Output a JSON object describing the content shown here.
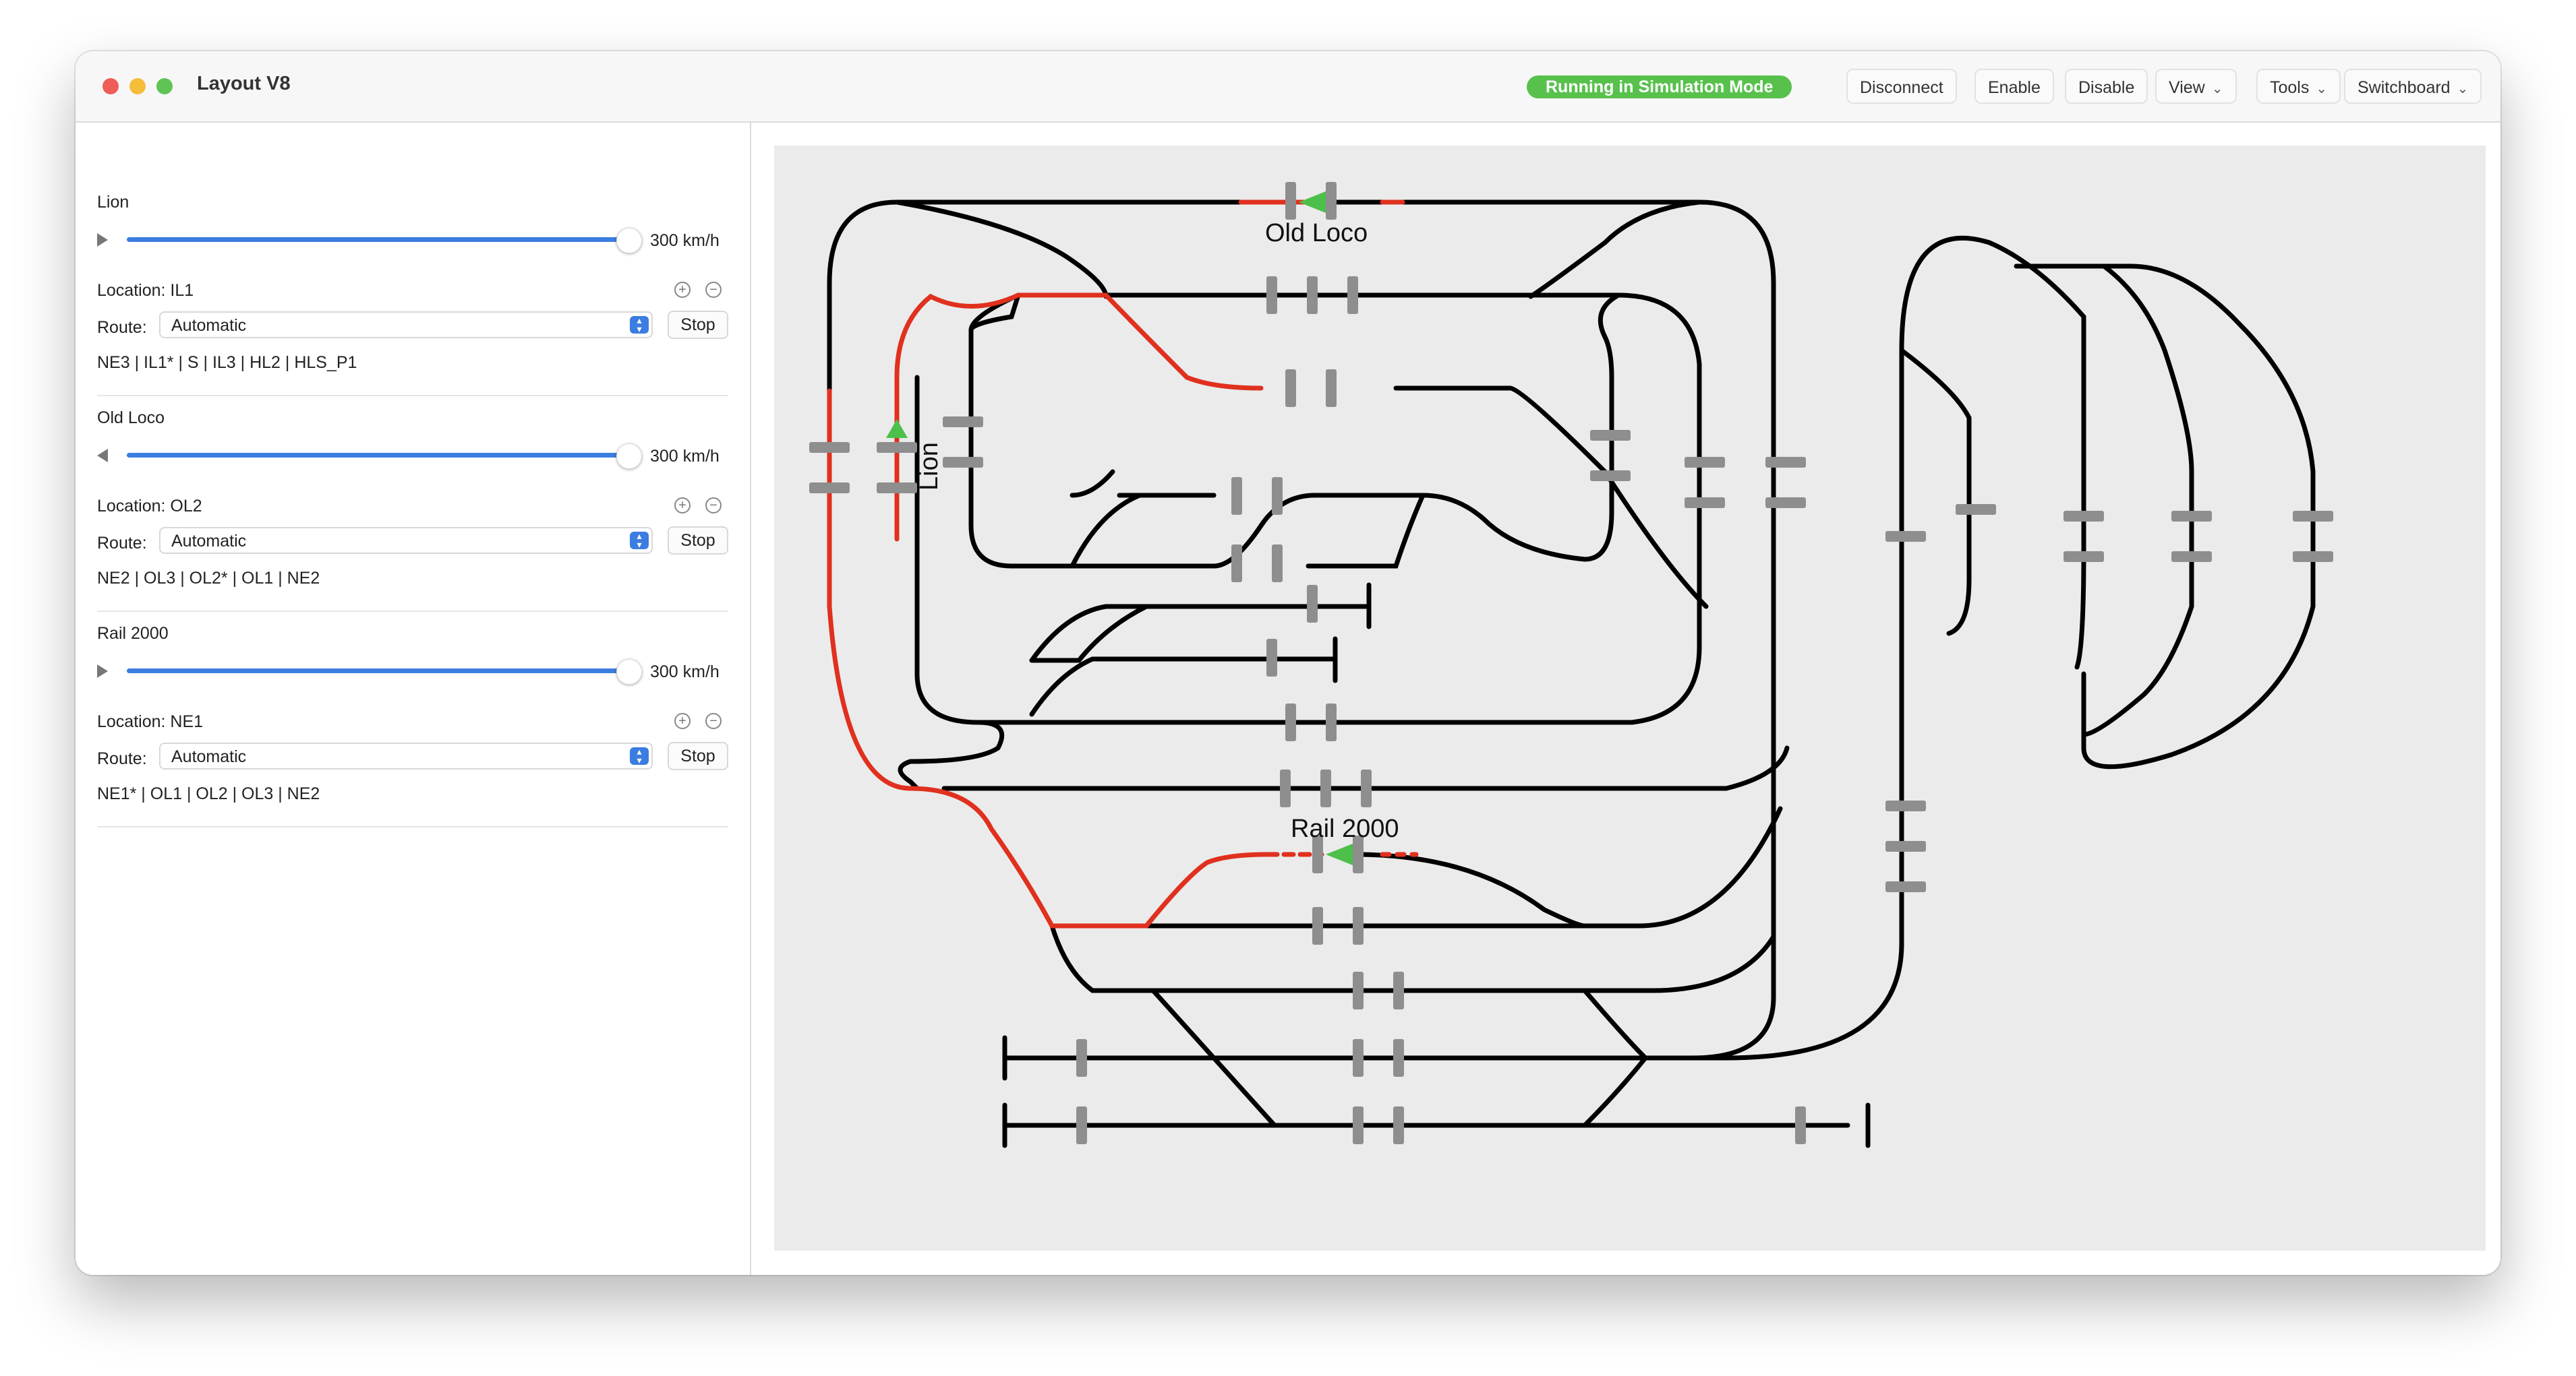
{
  "window": {
    "title": "Layout V8"
  },
  "toolbar": {
    "status": "Running in Simulation Mode",
    "status_color": "#58c14c",
    "disconnect": "Disconnect",
    "enable": "Enable",
    "disable": "Disable",
    "view": "View",
    "tools": "Tools",
    "switchboard": "Switchboard"
  },
  "trains": [
    {
      "name": "Lion",
      "direction_icon": "play-icon",
      "speed": "300 km/h",
      "speed_fraction": 1.0,
      "location": "Location: IL1",
      "route_label": "Route:",
      "route": "Automatic",
      "stop": "Stop",
      "path": "NE3 | IL1* | S | IL3 | HL2 | HLS_P1"
    },
    {
      "name": "Old Loco",
      "direction_icon": "back-icon",
      "speed": "300 km/h",
      "speed_fraction": 1.0,
      "location": "Location: OL2",
      "route_label": "Route:",
      "route": "Automatic",
      "stop": "Stop",
      "path": "NE2 | OL3 | OL2* | OL1 | NE2"
    },
    {
      "name": "Rail 2000",
      "direction_icon": "play-icon",
      "speed": "300 km/h",
      "speed_fraction": 1.0,
      "location": "Location: NE1",
      "route_label": "Route:",
      "route": "Automatic",
      "stop": "Stop",
      "path": "NE1* | OL1 | OL2 | OL3 | NE2"
    }
  ],
  "canvas": {
    "train_labels": {
      "old_loco": "Old Loco",
      "lion": "Lion",
      "rail2000": "Rail 2000"
    },
    "colors": {
      "track": "#000000",
      "route": "#e0301e",
      "train": "#4cc04a",
      "block": "#8e8e8e",
      "background": "#ebebeb"
    }
  }
}
